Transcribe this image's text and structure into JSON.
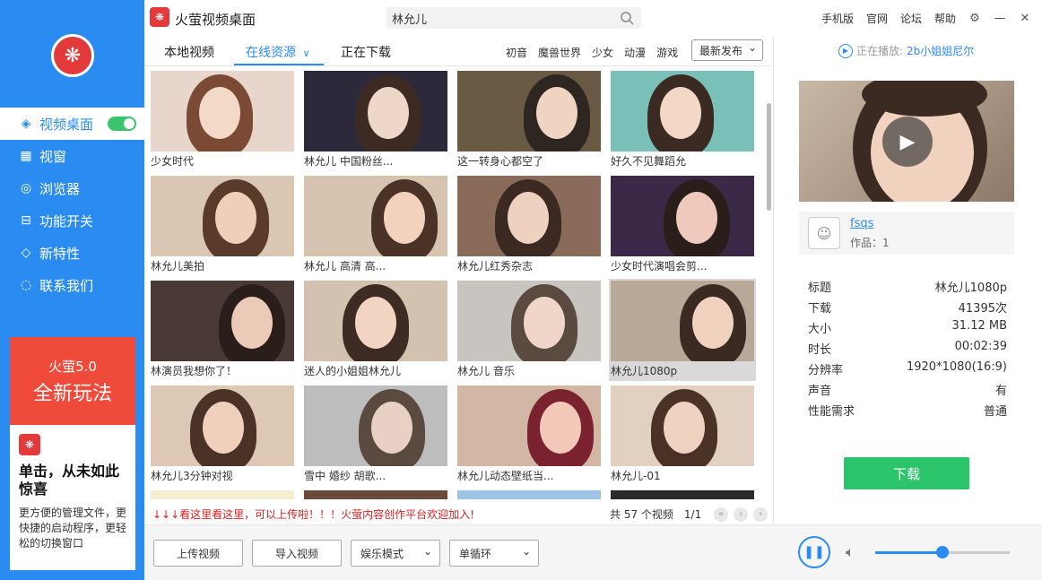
{
  "app": {
    "title": "火萤视频桌面"
  },
  "search": {
    "value": "林允儿"
  },
  "top_links": [
    "手机版",
    "官网",
    "论坛",
    "帮助"
  ],
  "sidebar": {
    "items": [
      {
        "label": "视频桌面",
        "icon": "video-desktop-icon"
      },
      {
        "label": "视窗",
        "icon": "window-grid-icon"
      },
      {
        "label": "浏览器",
        "icon": "browser-icon"
      },
      {
        "label": "功能开关",
        "icon": "switch-icon"
      },
      {
        "label": "新特性",
        "icon": "bulb-icon"
      },
      {
        "label": "联系我们",
        "icon": "chat-icon"
      }
    ],
    "toggle_on": true
  },
  "promo": {
    "version": "火萤5.0",
    "tagline": "全新玩法",
    "headline": "单击，从未如此惊喜",
    "desc": "更方便的管理文件，更快捷的启动程序，更轻松的切换窗口"
  },
  "tabs": {
    "local": "本地视频",
    "online": "在线资源",
    "downloading": "正在下载"
  },
  "categories": [
    "初音",
    "魔兽世界",
    "少女",
    "动漫",
    "游戏"
  ],
  "sort": {
    "selected": "最新发布"
  },
  "videos": [
    "少女时代",
    "林允儿 中国粉丝...",
    "这一转身心都空了",
    "好久不见舞蹈允",
    "林允儿美拍",
    "林允儿  高清   高...",
    "林允儿红秀杂志",
    "少女时代演唱会剪...",
    "林演员我想你了！",
    "迷人的小姐姐林允儿",
    "林允儿 音乐",
    "林允儿1080p",
    "林允儿3分钟对视",
    "雪中   婚纱   胡歌...",
    "林允儿动态壁纸当...",
    "林允儿-01"
  ],
  "notice": "↓↓↓看这里看这里，可以上传啦！！！火萤内容创作平台欢迎加入!",
  "pager": {
    "total": "共 57 个视频",
    "page": "1/1"
  },
  "bottom": {
    "upload": "上传视频",
    "import": "导入视频",
    "mode": "娱乐模式",
    "loop": "单循环"
  },
  "volume": {
    "level": 0.5
  },
  "now_playing": {
    "label": "正在播放:",
    "title": "2b小姐姐尼尔"
  },
  "author": {
    "name": "fsqs",
    "works": "作品：1"
  },
  "details": [
    {
      "k": "标题",
      "v": "林允儿1080p"
    },
    {
      "k": "下载",
      "v": "41395次"
    },
    {
      "k": "大小",
      "v": "31.12 MB"
    },
    {
      "k": "时长",
      "v": "00:02:39"
    },
    {
      "k": "分辨率",
      "v": "1920*1080(16:9)"
    },
    {
      "k": "声音",
      "v": "有"
    },
    {
      "k": "性能需求",
      "v": "普通"
    }
  ],
  "download_button": "下载",
  "colors": {
    "accent": "#2a8cf0",
    "brand_red": "#e23a3a",
    "download_green": "#2bc46b"
  }
}
